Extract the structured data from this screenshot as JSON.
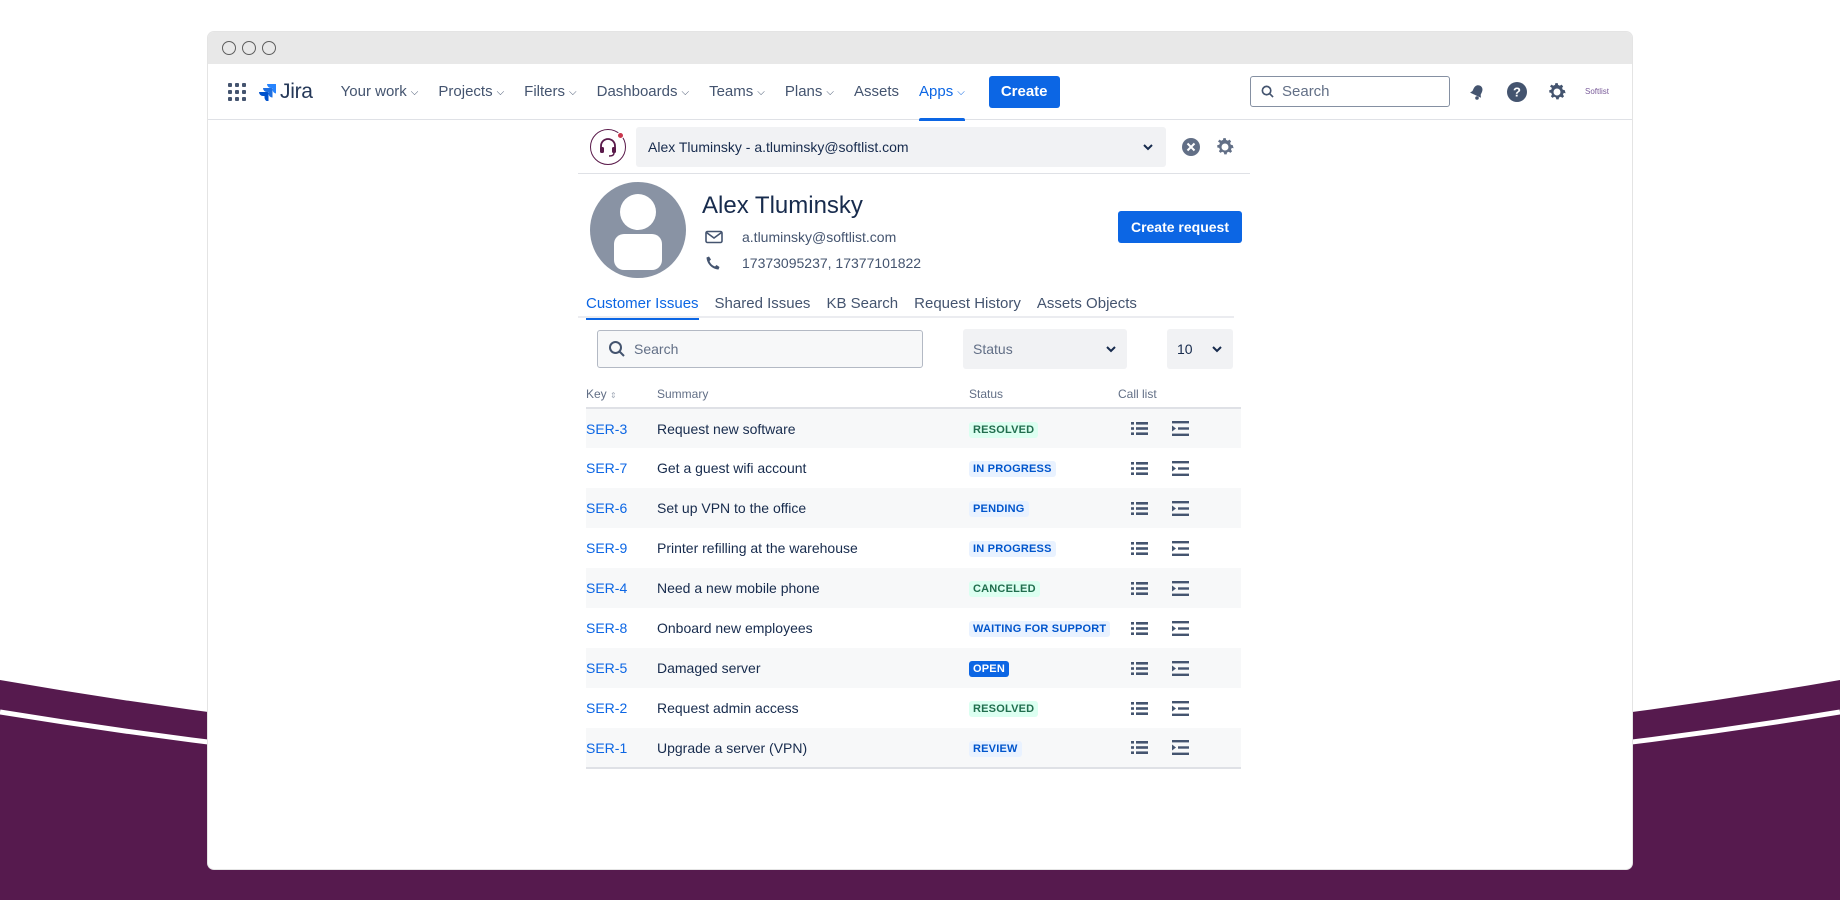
{
  "colors": {
    "accent": "#0c66e4",
    "brand_bg": "#561a4e",
    "window_chrome": "#e8e8e8"
  },
  "nav": {
    "logo_text": "Jira",
    "items": [
      {
        "label": "Your work",
        "icon": "chevron-down-icon"
      },
      {
        "label": "Projects",
        "icon": "chevron-down-icon"
      },
      {
        "label": "Filters",
        "icon": "chevron-down-icon"
      },
      {
        "label": "Dashboards",
        "icon": "chevron-down-icon"
      },
      {
        "label": "Teams",
        "icon": "chevron-down-icon"
      },
      {
        "label": "Plans",
        "icon": "chevron-down-icon"
      },
      {
        "label": "Assets"
      },
      {
        "label": "Apps",
        "icon": "chevron-down-icon",
        "active": true
      }
    ],
    "create_label": "Create",
    "search_placeholder": "Search",
    "avatar_text": "Softlist",
    "icons": [
      "notification-bell-icon",
      "help-icon",
      "settings-gear-icon"
    ]
  },
  "customer": {
    "selector_value": "Alex Tluminsky - a.tluminsky@softlist.com",
    "name": "Alex Tluminsky",
    "email": "a.tluminsky@softlist.com",
    "phone": "17373095237, 17377101822",
    "create_request_label": "Create request"
  },
  "tabs": [
    {
      "label": "Customer Issues",
      "active": true
    },
    {
      "label": "Shared Issues"
    },
    {
      "label": "KB Search"
    },
    {
      "label": "Request History"
    },
    {
      "label": "Assets Objects"
    }
  ],
  "filters": {
    "search_placeholder": "Search",
    "status_placeholder": "Status",
    "page_size": "10"
  },
  "table": {
    "headers": {
      "key": "Key",
      "summary": "Summary",
      "status": "Status",
      "call_list": "Call list"
    },
    "rows": [
      {
        "key": "SER-3",
        "summary": "Request new software",
        "status": "RESOLVED",
        "status_style": "green"
      },
      {
        "key": "SER-7",
        "summary": "Get a guest wifi account",
        "status": "IN PROGRESS",
        "status_style": "blue"
      },
      {
        "key": "SER-6",
        "summary": "Set up VPN to the office",
        "status": "PENDING",
        "status_style": "blue"
      },
      {
        "key": "SER-9",
        "summary": "Printer refilling at the warehouse",
        "status": "IN PROGRESS",
        "status_style": "blue"
      },
      {
        "key": "SER-4",
        "summary": "Need a new mobile phone",
        "status": "CANCELED",
        "status_style": "green"
      },
      {
        "key": "SER-8",
        "summary": "Onboard new employees",
        "status": "WAITING FOR SUPPORT",
        "status_style": "blue"
      },
      {
        "key": "SER-5",
        "summary": "Damaged server",
        "status": "OPEN",
        "status_style": "solid"
      },
      {
        "key": "SER-2",
        "summary": "Request admin access",
        "status": "RESOLVED",
        "status_style": "green"
      },
      {
        "key": "SER-1",
        "summary": "Upgrade a server (VPN)",
        "status": "REVIEW",
        "status_style": "blue"
      }
    ]
  }
}
